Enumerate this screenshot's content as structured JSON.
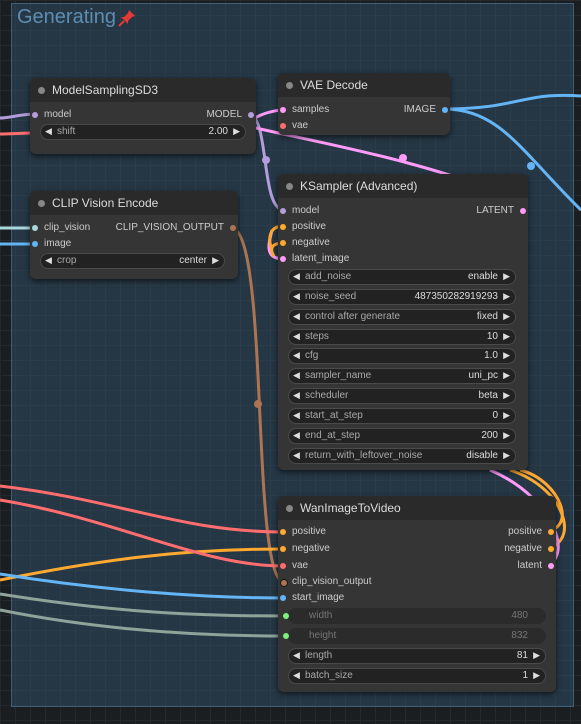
{
  "group": {
    "title": "Generating"
  },
  "nodes": {
    "model_sampling": {
      "title": "ModelSamplingSD3",
      "in_model": "model",
      "out_model": "MODEL",
      "widgets": [
        {
          "label": "shift",
          "value": "2.00"
        }
      ]
    },
    "vae_decode": {
      "title": "VAE Decode",
      "in_samples": "samples",
      "in_vae": "vae",
      "out_image": "IMAGE"
    },
    "clip_vision": {
      "title": "CLIP Vision Encode",
      "in_clip_vision": "clip_vision",
      "in_image": "image",
      "out": "CLIP_VISION_OUTPUT",
      "widgets": [
        {
          "label": "crop",
          "value": "center"
        }
      ]
    },
    "ksampler": {
      "title": "KSampler (Advanced)",
      "in_model": "model",
      "in_positive": "positive",
      "in_negative": "negative",
      "in_latent": "latent_image",
      "out_latent": "LATENT",
      "widgets": [
        {
          "label": "add_noise",
          "value": "enable"
        },
        {
          "label": "noise_seed",
          "value": "487350282919293"
        },
        {
          "label": "control after generate",
          "value": "fixed"
        },
        {
          "label": "steps",
          "value": "10"
        },
        {
          "label": "cfg",
          "value": "1.0"
        },
        {
          "label": "sampler_name",
          "value": "uni_pc"
        },
        {
          "label": "scheduler",
          "value": "beta"
        },
        {
          "label": "start_at_step",
          "value": "0"
        },
        {
          "label": "end_at_step",
          "value": "200"
        },
        {
          "label": "return_with_leftover_noise",
          "value": "disable"
        }
      ]
    },
    "wan": {
      "title": "WanImageToVideo",
      "in_positive": "positive",
      "in_negative": "negative",
      "in_vae": "vae",
      "in_clip_vision_output": "clip_vision_output",
      "in_start_image": "start_image",
      "out_positive": "positive",
      "out_negative": "negative",
      "out_latent": "latent",
      "widgets": [
        {
          "label": "width",
          "value": "480"
        },
        {
          "label": "height",
          "value": "832"
        },
        {
          "label": "length",
          "value": "81"
        },
        {
          "label": "batch_size",
          "value": "1"
        }
      ]
    }
  },
  "colors": {
    "model": "#b39ddb",
    "vae": "#ff6e6e",
    "latent": "#ff9cf9",
    "conditioning": "#ffa931",
    "image": "#64b5f6",
    "clip_vision": "#a8dadc",
    "clip_vision_output": "#ad7452",
    "int": "#7cf07c"
  }
}
